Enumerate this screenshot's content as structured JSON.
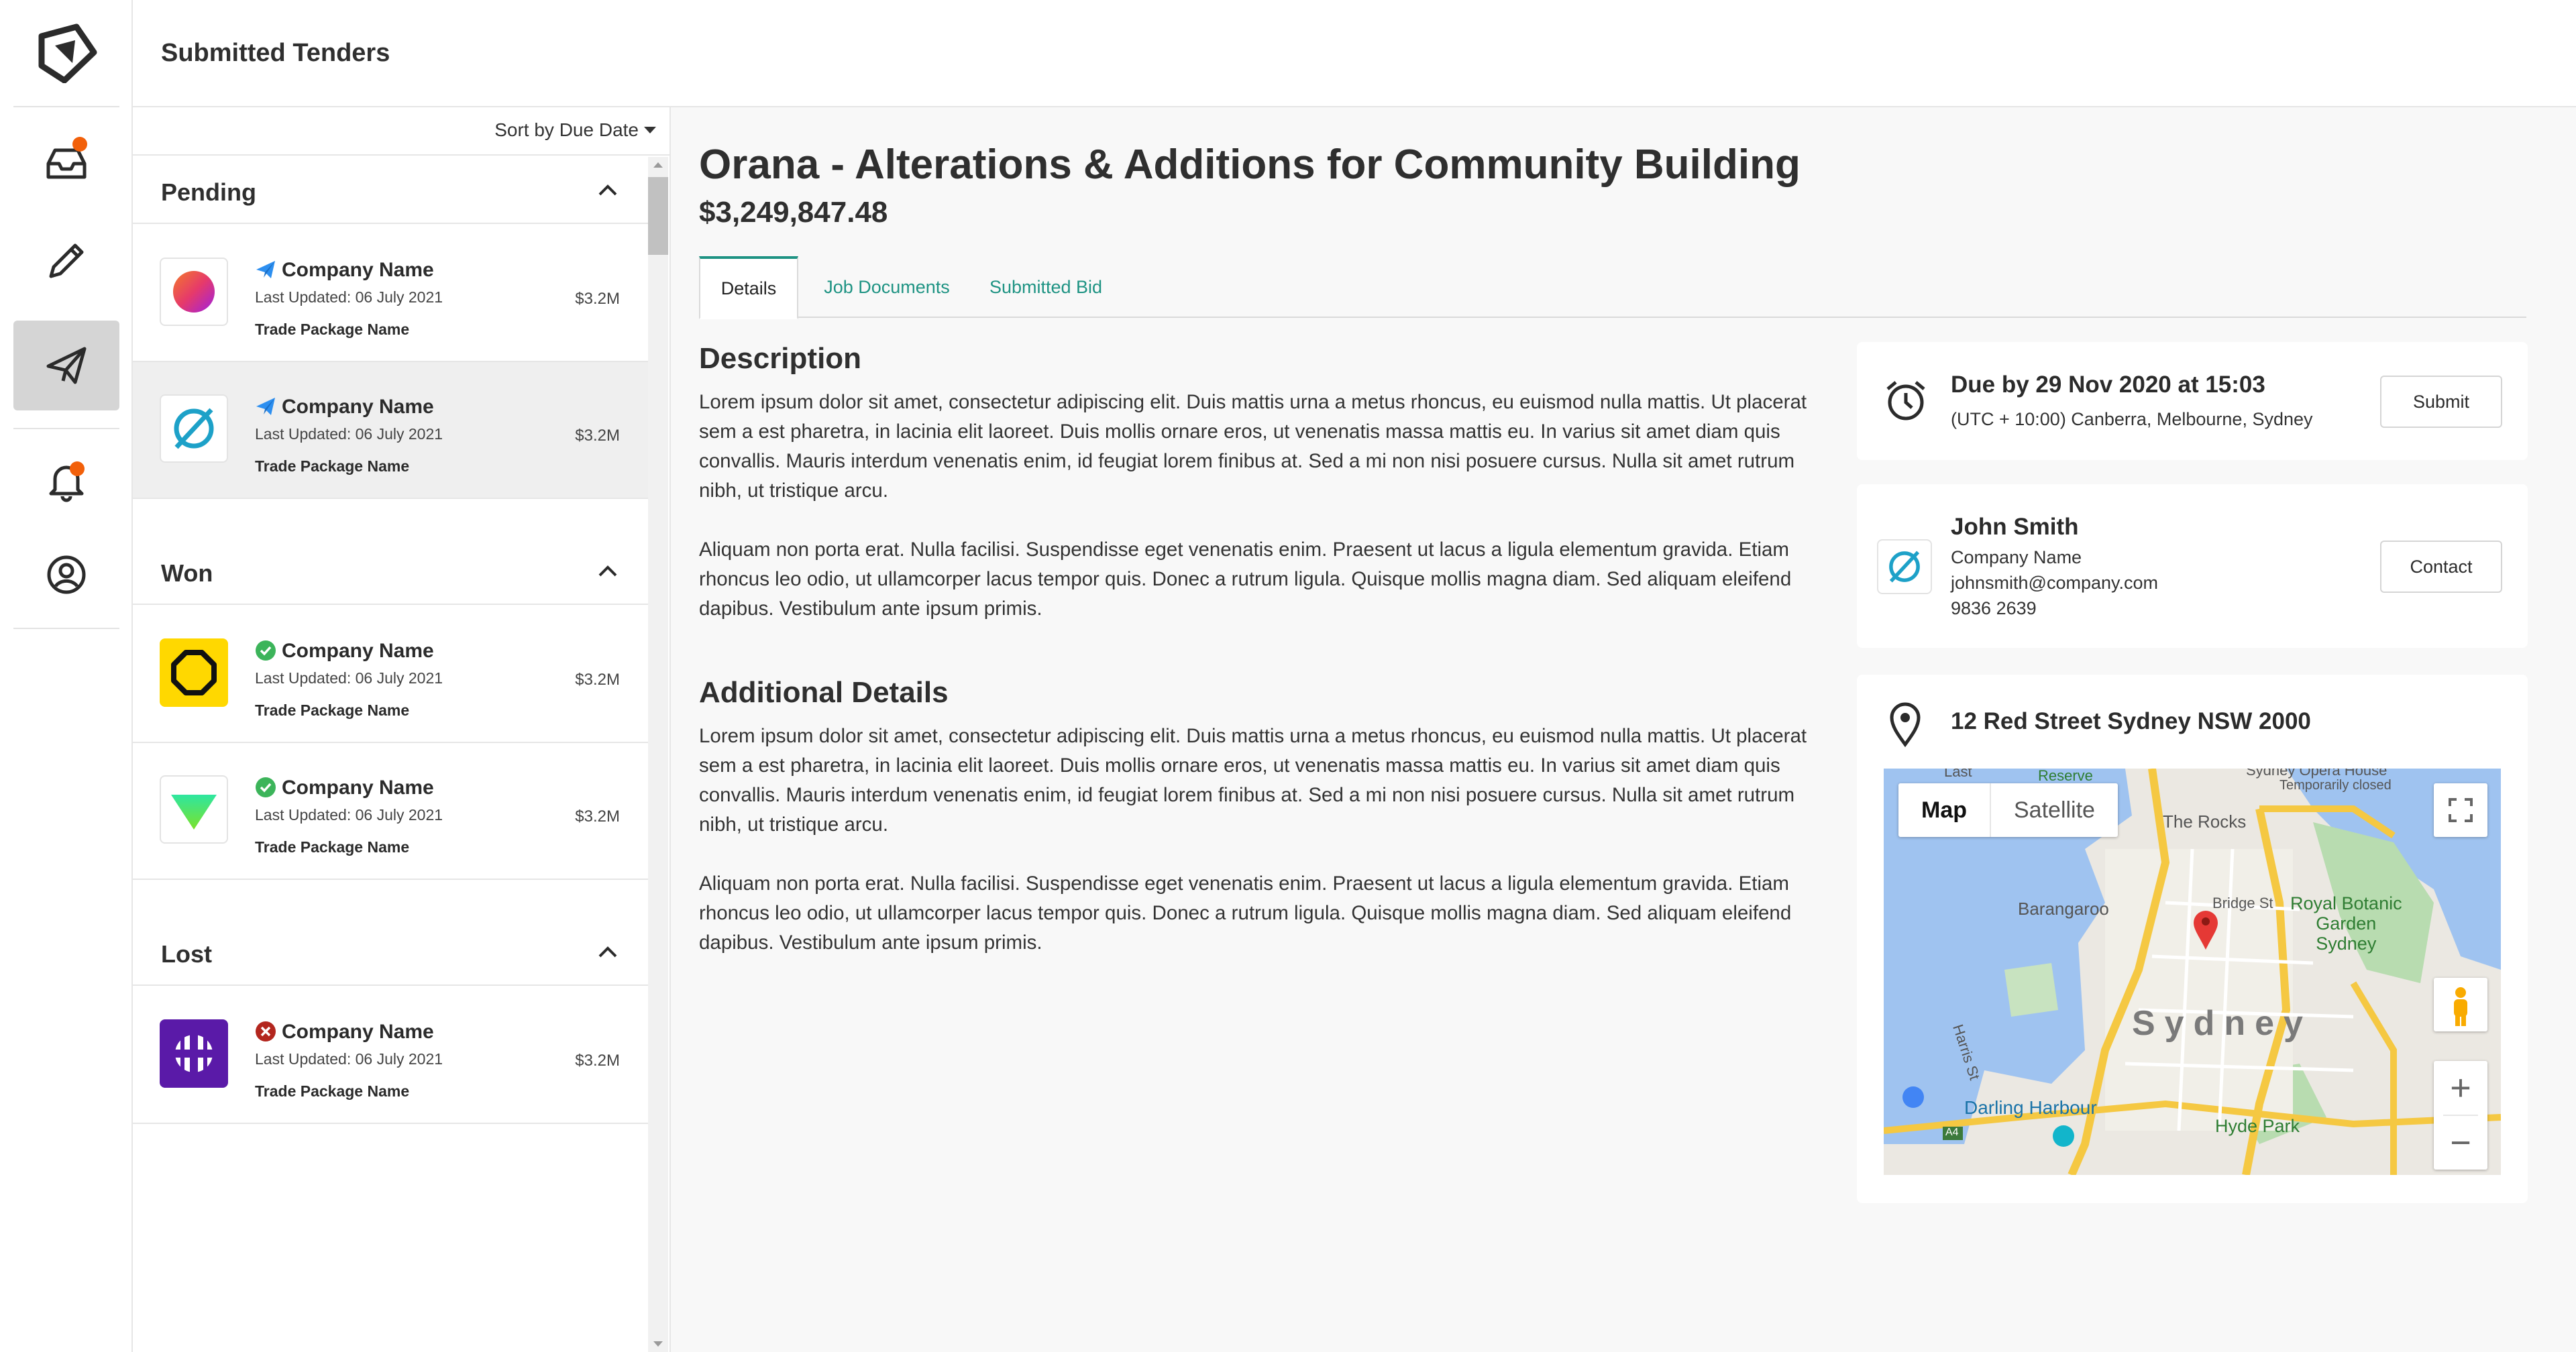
{
  "app": {
    "header_title": "Submitted Tenders"
  },
  "nav": {
    "items": [
      {
        "name": "inbox",
        "icon": "inbox-icon",
        "badge": true
      },
      {
        "name": "edit",
        "icon": "pencil-icon",
        "badge": false
      },
      {
        "name": "submitted",
        "icon": "paper-plane-icon",
        "badge": false,
        "active": true
      },
      {
        "name": "notifications",
        "icon": "bell-icon",
        "badge": true
      },
      {
        "name": "account",
        "icon": "user-circle-icon",
        "badge": false
      }
    ]
  },
  "list": {
    "sort_label": "Sort by Due Date",
    "sections": [
      {
        "label": "Pending",
        "items": [
          {
            "company": "Company Name",
            "updated": "Last Updated: 06 July 2021",
            "package": "Trade Package Name",
            "value": "$3.2M",
            "status": "sent",
            "logo": "gradient-circle"
          },
          {
            "company": "Company Name",
            "updated": "Last Updated: 06 July 2021",
            "package": "Trade Package Name",
            "value": "$3.2M",
            "status": "sent",
            "logo": "empty-set",
            "selected": true
          }
        ]
      },
      {
        "label": "Won",
        "items": [
          {
            "company": "Company Name",
            "updated": "Last Updated: 06 July 2021",
            "package": "Trade Package Name",
            "value": "$3.2M",
            "status": "won",
            "logo": "octagon"
          },
          {
            "company": "Company Name",
            "updated": "Last Updated: 06 July 2021",
            "package": "Trade Package Name",
            "value": "$3.2M",
            "status": "won",
            "logo": "triangle"
          }
        ]
      },
      {
        "label": "Lost",
        "items": [
          {
            "company": "Company Name",
            "updated": "Last Updated: 06 July 2021",
            "package": "Trade Package Name",
            "value": "$3.2M",
            "status": "lost",
            "logo": "grid-circle"
          }
        ]
      }
    ]
  },
  "detail": {
    "title": "Orana - Alterations & Additions for Community Building",
    "value": "$3,249,847.48",
    "tabs": [
      "Details",
      "Job Documents",
      "Submitted Bid"
    ],
    "active_tab": "Details",
    "description_heading": "Description",
    "description_p1": "Lorem ipsum dolor sit amet, consectetur adipiscing elit. Duis mattis urna a metus rhoncus, eu euismod nulla mattis. Ut placerat sem a est pharetra, in lacinia elit laoreet. Duis mollis ornare eros, ut venenatis massa mattis eu. In varius sit amet diam quis convallis. Mauris interdum venenatis enim, id feugiat lorem finibus at. Sed a mi non nisi posuere cursus. Nulla sit amet rutrum nibh, ut tristique arcu.",
    "description_p2": "Aliquam non porta erat. Nulla facilisi. Suspendisse eget venenatis enim. Praesent ut lacus a ligula elementum gravida. Etiam rhoncus leo odio, ut ullamcorper lacus tempor quis. Donec a rutrum ligula. Quisque mollis magna diam. Sed aliquam eleifend dapibus. Vestibulum ante ipsum primis.",
    "additional_heading": "Additional Details",
    "additional_p1": "Lorem ipsum dolor sit amet, consectetur adipiscing elit. Duis mattis urna a metus rhoncus, eu euismod nulla mattis. Ut placerat sem a est pharetra, in lacinia elit laoreet. Duis mollis ornare eros, ut venenatis massa mattis eu. In varius sit amet diam quis convallis. Mauris interdum venenatis enim, id feugiat lorem finibus at. Sed a mi non nisi posuere cursus. Nulla sit amet rutrum nibh, ut tristique arcu.",
    "additional_p2": "Aliquam non porta erat. Nulla facilisi. Suspendisse eget venenatis enim. Praesent ut lacus a ligula elementum gravida. Etiam rhoncus leo odio, ut ullamcorper lacus tempor quis. Donec a rutrum ligula. Quisque mollis magna diam. Sed aliquam eleifend dapibus. Vestibulum ante ipsum primis."
  },
  "due_card": {
    "due": "Due by 29 Nov 2020 at 15:03",
    "timezone": "(UTC + 10:00) Canberra, Melbourne, Sydney",
    "button": "Submit"
  },
  "contact_card": {
    "name": "John Smith",
    "company": "Company Name",
    "email": "johnsmith@company.com",
    "phone": "9836 2639",
    "button": "Contact"
  },
  "location_card": {
    "address": "12 Red Street Sydney NSW 2000",
    "map": {
      "type_map": "Map",
      "type_satellite": "Satellite",
      "labels": {
        "rocks": "The Rocks",
        "barangaroo": "Barangaroo",
        "bridge_st": "Bridge St",
        "royal_botanic": "Royal Botanic\nGarden\nSydney",
        "sydney": "Sydney",
        "harris_st": "Harris St",
        "darling_harbour": "Darling Harbour",
        "hyde_park": "Hyde Park",
        "a4": "A4",
        "opera_house": "Sydney Opera House",
        "temporarily_closed": "Temporarily closed",
        "reserve": "Reserve",
        "last": "Last"
      }
    }
  },
  "colors": {
    "accent_teal": "#1e9383",
    "badge_orange": "#f2600a",
    "sent_blue": "#2d8ff0",
    "won_green": "#3cb45a",
    "lost_red": "#b3261e",
    "map_pin": "#e53935"
  }
}
